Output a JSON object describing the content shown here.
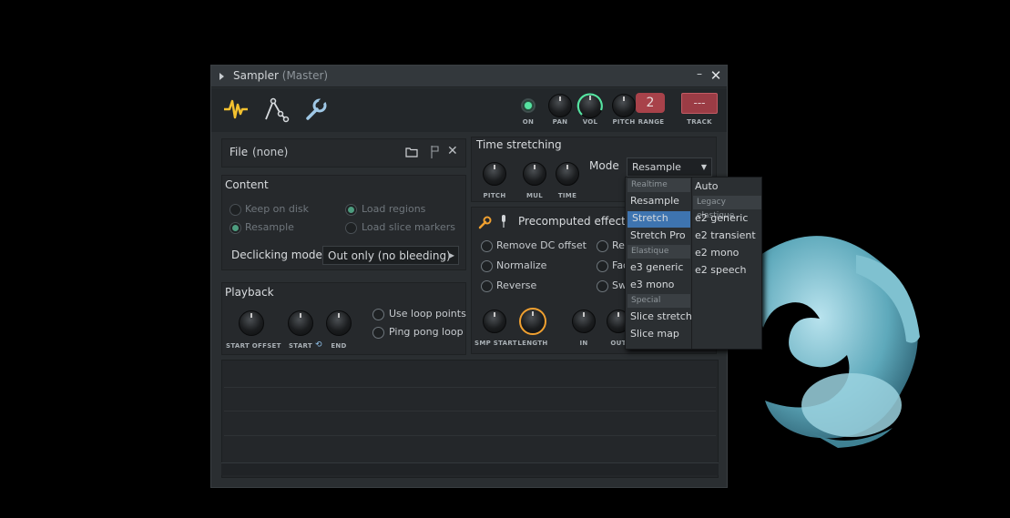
{
  "window": {
    "title": "Sampler",
    "title_sub": "(Master)",
    "minimize_glyph": "–",
    "close_glyph": "✕"
  },
  "toolbar": {
    "icons": [
      "wave-sparkle-icon",
      "envelope-icon",
      "wrench-icon"
    ],
    "on_label": "ON",
    "pan_label": "PAN",
    "vol_label": "VOL",
    "pitch_label": "PITCH",
    "range_label": "RANGE",
    "range_value": "2",
    "track_label": "TRACK",
    "track_value": "---",
    "accent": "#56e3a1"
  },
  "file": {
    "label": "File",
    "value": "(none)"
  },
  "content": {
    "heading": "Content",
    "options": [
      {
        "label": "Keep on disk",
        "checked": false
      },
      {
        "label": "Load regions",
        "checked": true
      },
      {
        "label": "Resample",
        "checked": true
      },
      {
        "label": "Load slice markers",
        "checked": false
      }
    ],
    "declicking_label": "Declicking mode",
    "declicking_value": "Out only (no bleeding)"
  },
  "playback": {
    "heading": "Playback",
    "knobs": [
      "START OFFSET",
      "START",
      "END"
    ],
    "options": [
      "Use loop points",
      "Ping pong loop"
    ]
  },
  "time_stretching": {
    "heading": "Time stretching",
    "knobs": [
      "PITCH",
      "MUL",
      "TIME"
    ],
    "mode_label": "Mode",
    "mode_value": "Resample"
  },
  "precomputed": {
    "heading": "Precomputed effects",
    "options": [
      "Remove DC offset",
      "Normalize",
      "Reverse"
    ],
    "options_right": [
      "Rev",
      "Fac",
      "Swa"
    ],
    "knobs": [
      "SMP START",
      "LENGTH",
      "IN",
      "OUT"
    ],
    "length_color": "#f0a030"
  },
  "mode_menu": {
    "col1": [
      {
        "type": "header",
        "label": "Realtime"
      },
      {
        "type": "item",
        "label": "Resample"
      },
      {
        "type": "item",
        "label": "Stretch",
        "selected": true
      },
      {
        "type": "item",
        "label": "Stretch Pro"
      },
      {
        "type": "header",
        "label": "Elastique"
      },
      {
        "type": "item",
        "label": "e3 generic"
      },
      {
        "type": "item",
        "label": "e3 mono"
      },
      {
        "type": "header",
        "label": "Special"
      },
      {
        "type": "item",
        "label": "Slice stretch"
      },
      {
        "type": "item",
        "label": "Slice map"
      }
    ],
    "col2": [
      {
        "type": "item",
        "label": "Auto"
      },
      {
        "type": "header",
        "label": "Legacy elastique"
      },
      {
        "type": "item",
        "label": "e2 generic"
      },
      {
        "type": "item",
        "label": "e2 transient"
      },
      {
        "type": "item",
        "label": "e2 mono"
      },
      {
        "type": "item",
        "label": "e2 speech"
      }
    ],
    "selected_color": "#3e74b0"
  }
}
